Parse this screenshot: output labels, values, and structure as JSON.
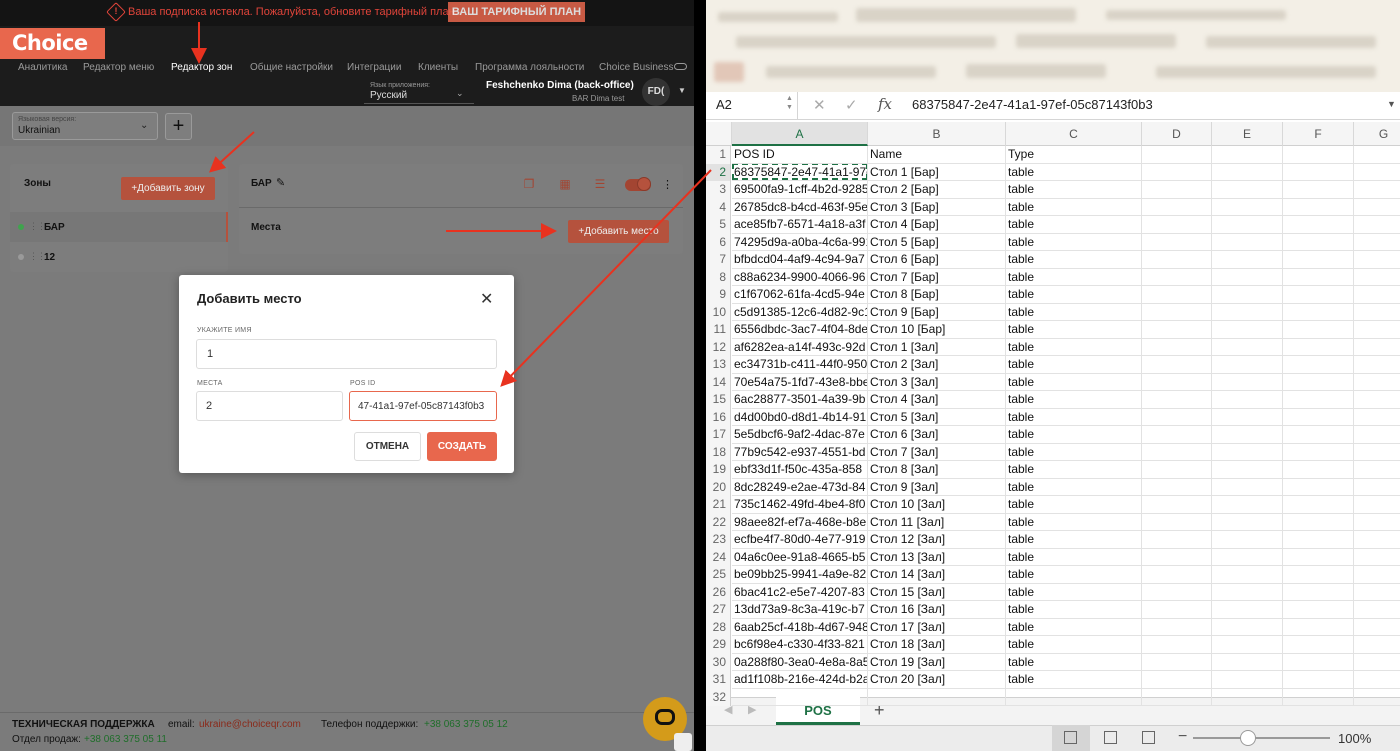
{
  "app": {
    "warning_text": "Ваша подписка истекла. Пожалуйста, обновите тарифный план.",
    "plan_button": "ВАШ ТАРИФНЫЙ ПЛАН",
    "logo": "Choice",
    "nav": [
      {
        "label": "Аналитика",
        "active": false
      },
      {
        "label": "Редактор меню",
        "active": false
      },
      {
        "label": "Редактор зон",
        "active": true
      },
      {
        "label": "Общие настройки",
        "active": false
      },
      {
        "label": "Интеграции",
        "active": false
      },
      {
        "label": "Клиенты",
        "active": false
      },
      {
        "label": "Программа лояльности",
        "active": false
      },
      {
        "label": "Choice Business",
        "active": false
      }
    ],
    "app_lang_label": "Язык приложения:",
    "app_lang_value": "Русский",
    "user_name": "Feshchenko Dima (back-office)",
    "user_sub": "BAR Dima test",
    "avatar": "FD(",
    "version_label": "Языковая версия:",
    "version_value": "Ukrainian",
    "plus": "+",
    "zones_title": "Зоны",
    "add_zone": "+Добавить зону",
    "zones": [
      {
        "name": "БАР",
        "status_color": "#3fa34d"
      },
      {
        "name": "12",
        "status_color": "#9a9a9a"
      }
    ],
    "bar_title": "БАР",
    "places_label": "Места",
    "add_place": "+Добавить место",
    "modal": {
      "title": "Добавить место",
      "close": "✕",
      "name_label": "УКАЖИТЕ ИМЯ",
      "name_value": "1",
      "seats_label": "МЕСТА",
      "seats_value": "2",
      "posid_label": "POS ID",
      "posid_value": "47-41a1-97ef-05c87143f0b3",
      "cancel": "ОТМЕНА",
      "create": "СОЗДАТЬ"
    },
    "footer": {
      "support_title": "ТЕХНИЧЕСКАЯ ПОДДЕРЖКА",
      "email_label": "email:",
      "email": "ukraine@choiceqr.com",
      "phone_label": "Телефон поддержки:",
      "phone": "+38 063 375 05 12",
      "sales_label": "Отдел продаж:",
      "sales_phone": "+38 063 375 05 11"
    },
    "colors": {
      "accent": "#e8674d",
      "green": "#3fa34d"
    }
  },
  "excel": {
    "namebox": "A2",
    "fx": "fx",
    "formula": "68375847-2e47-41a1-97ef-05c87143f0b3",
    "columns": [
      "A",
      "B",
      "C",
      "D",
      "E",
      "F",
      "G"
    ],
    "rows": [
      [
        "POS ID",
        "Name",
        "Type"
      ],
      [
        "68375847-2e47-41a1-97ef-05c87143f0b3",
        "Стол 1 [Бар]",
        "table"
      ],
      [
        "69500fa9-1cff-4b2d-9285",
        "Стол 2 [Бар]",
        "table"
      ],
      [
        "26785dc8-b4cd-463f-95e",
        "Стол 3 [Бар]",
        "table"
      ],
      [
        "ace85fb7-6571-4a18-a3f",
        "Стол 4 [Бар]",
        "table"
      ],
      [
        "74295d9a-a0ba-4c6a-991",
        "Стол 5 [Бар]",
        "table"
      ],
      [
        "bfbdcd04-4af9-4c94-9a7",
        "Стол 6 [Бар]",
        "table"
      ],
      [
        "c88a6234-9900-4066-96",
        "Стол 7 [Бар]",
        "table"
      ],
      [
        "c1f67062-61fa-4cd5-94e",
        "Стол 8 [Бар]",
        "table"
      ],
      [
        "c5d91385-12c6-4d82-9c1",
        "Стол 9 [Бар]",
        "table"
      ],
      [
        "6556dbdc-3ac7-4f04-8de",
        "Стол 10 [Бар]",
        "table"
      ],
      [
        "af6282ea-a14f-493c-92d",
        "Стол 1 [Зал]",
        "table"
      ],
      [
        "ec34731b-c411-44f0-950",
        "Стол 2 [Зал]",
        "table"
      ],
      [
        "70e54a75-1fd7-43e8-bbe",
        "Стол 3 [Зал]",
        "table"
      ],
      [
        "6ac28877-3501-4a39-9b",
        "Стол 4 [Зал]",
        "table"
      ],
      [
        "d4d00bd0-d8d1-4b14-91",
        "Стол 5 [Зал]",
        "table"
      ],
      [
        "5e5dbcf6-9af2-4dac-87e",
        "Стол 6 [Зал]",
        "table"
      ],
      [
        "77b9c542-e937-4551-bd",
        "Стол 7 [Зал]",
        "table"
      ],
      [
        "ebf33d1f-f50c-435a-858",
        "Стол 8 [Зал]",
        "table"
      ],
      [
        "8dc28249-e2ae-473d-84",
        "Стол 9 [Зал]",
        "table"
      ],
      [
        "735c1462-49fd-4be4-8f0",
        "Стол 10 [Зал]",
        "table"
      ],
      [
        "98aee82f-ef7a-468e-b8e",
        "Стол 11 [Зал]",
        "table"
      ],
      [
        "ecfbe4f7-80d0-4e77-919",
        "Стол 12 [Зал]",
        "table"
      ],
      [
        "04a6c0ee-91a8-4665-b5",
        "Стол 13 [Зал]",
        "table"
      ],
      [
        "be09bb25-9941-4a9e-82",
        "Стол 14 [Зал]",
        "table"
      ],
      [
        "6bac41c2-e5e7-4207-83",
        "Стол 15 [Зал]",
        "table"
      ],
      [
        "13dd73a9-8c3a-419c-b7",
        "Стол 16 [Зал]",
        "table"
      ],
      [
        "6aab25cf-418b-4d67-948",
        "Стол 17 [Зал]",
        "table"
      ],
      [
        "bc6f98e4-c330-4f33-821",
        "Стол 18 [Зал]",
        "table"
      ],
      [
        "0a288f80-3ea0-4e8a-8a5",
        "Стол 19 [Зал]",
        "table"
      ],
      [
        "ad1f108b-216e-424d-b2a",
        "Стол 20 [Зал]",
        "table"
      ],
      [
        "",
        "",
        ""
      ]
    ],
    "sheet_tab": "POS",
    "add_sheet": "+",
    "zoom": "100%",
    "colors": {
      "excel_green": "#1e7145"
    }
  }
}
